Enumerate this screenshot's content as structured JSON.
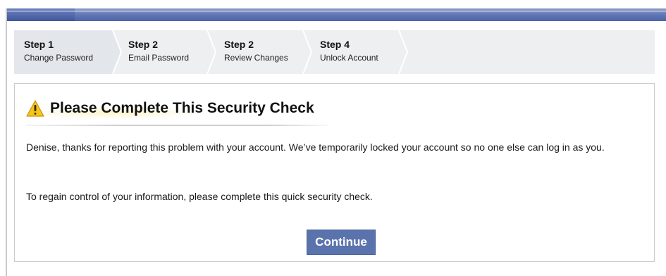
{
  "steps": [
    {
      "number": "Step 1",
      "label": "Change Password"
    },
    {
      "number": "Step 2",
      "label": "Email Password"
    },
    {
      "number": "Step 2",
      "label": "Review Changes"
    },
    {
      "number": "Step 4",
      "label": "Unlock Account"
    }
  ],
  "message": {
    "heading": "Please Complete This Security Check",
    "paragraph1": "Denise, thanks for reporting this problem with your account. We’ve temporarily locked your account so no one else can log in as you.",
    "paragraph2": "To regain control of your information, please complete this quick security check.",
    "continue_label": "Continue"
  },
  "colors": {
    "topbar": "#5e74b4",
    "button": "#5b73ad",
    "step_bar": "#edeff1",
    "active_step": "#e3e6ea",
    "warning": "#f5c518"
  },
  "icons": {
    "heading_icon": "warning-icon"
  }
}
